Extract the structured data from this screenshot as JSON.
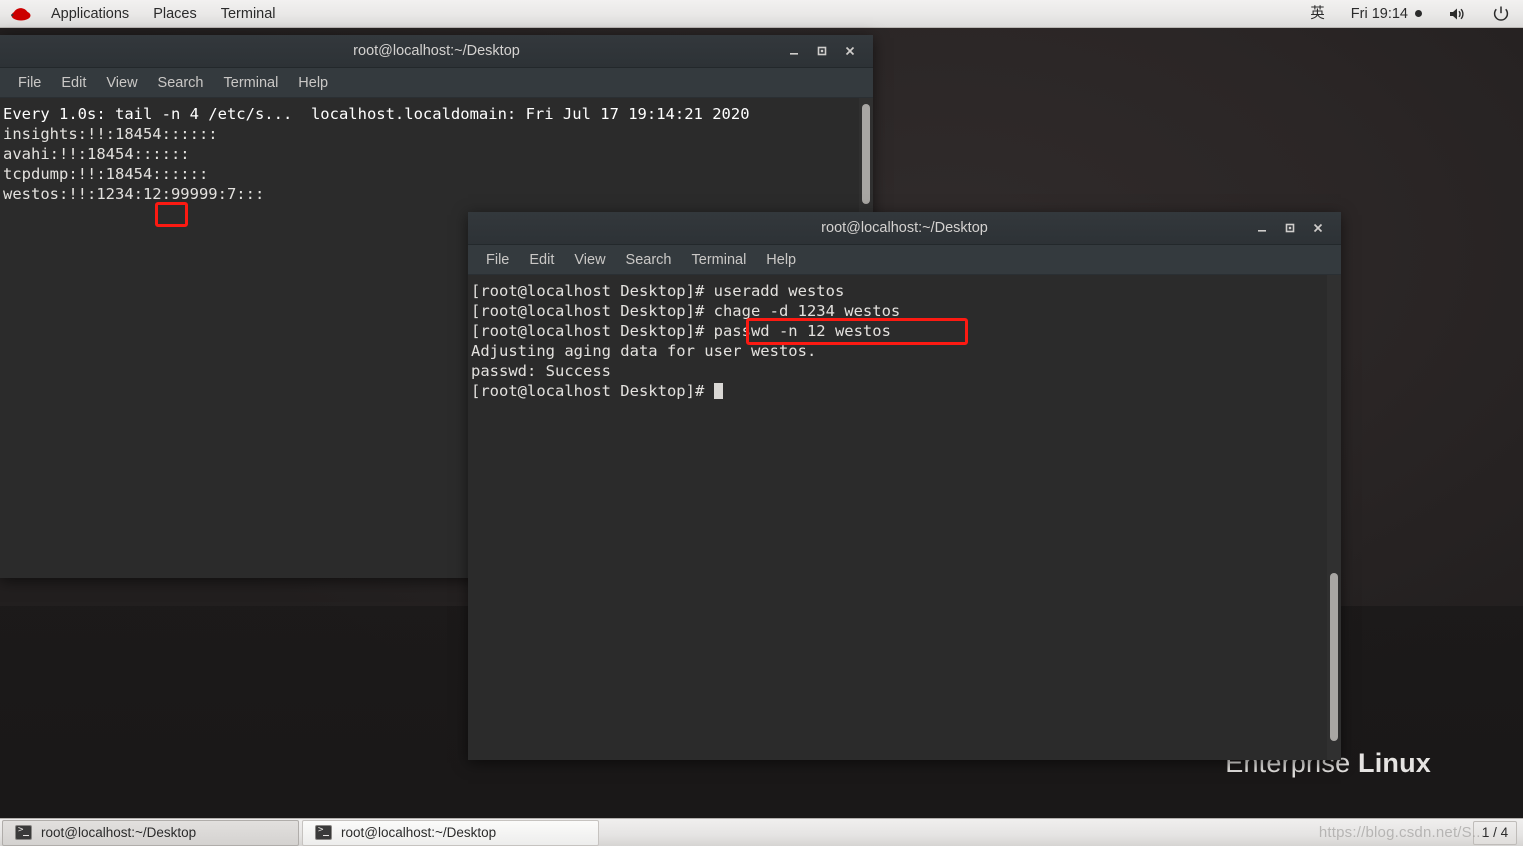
{
  "top_panel": {
    "logo_icon": "redhat-logo-icon",
    "menus": [
      "Applications",
      "Places",
      "Terminal"
    ],
    "input_method": "英",
    "clock": "Fri 19:14",
    "volume_icon": "volume-icon",
    "power_icon": "power-icon"
  },
  "desktop": {
    "brand_thin": "Enterprise",
    "brand_bold": "Linux"
  },
  "terminal1": {
    "title": "root@localhost:~/Desktop",
    "menus": [
      "File",
      "Edit",
      "View",
      "Search",
      "Terminal",
      "Help"
    ],
    "window_controls": {
      "minimize": "_",
      "maximize": "□",
      "close": "✕"
    },
    "lines": [
      "Every 1.0s: tail -n 4 /etc/s...  localhost.localdomain: Fri Jul 17 19:14:21 2020",
      "",
      "insights:!!:18454::::::",
      "avahi:!!:18454::::::",
      "tcpdump:!!:18454::::::",
      "westos:!!:1234:12:99999:7:::"
    ]
  },
  "terminal2": {
    "title": "root@localhost:~/Desktop",
    "menus": [
      "File",
      "Edit",
      "View",
      "Search",
      "Terminal",
      "Help"
    ],
    "window_controls": {
      "minimize": "_",
      "maximize": "□",
      "close": "✕"
    },
    "lines": [
      "[root@localhost Desktop]# useradd westos",
      "[root@localhost Desktop]# chage -d 1234 westos",
      "[root@localhost Desktop]# passwd -n 12 westos",
      "Adjusting aging data for user westos.",
      "passwd: Success",
      "[root@localhost Desktop]# "
    ]
  },
  "annotations": {
    "color": "#fc1a12",
    "box1_target": "12",
    "box2_target": "passwd -n 12 westos"
  },
  "taskbar": {
    "items": [
      {
        "label": "root@localhost:~/Desktop",
        "icon": "terminal-icon",
        "state": "active"
      },
      {
        "label": "root@localhost:~/Desktop",
        "icon": "terminal-icon",
        "state": "inactive"
      }
    ],
    "workspace": "1 / 4"
  },
  "watermark": "https://blog.csdn.net/S..."
}
